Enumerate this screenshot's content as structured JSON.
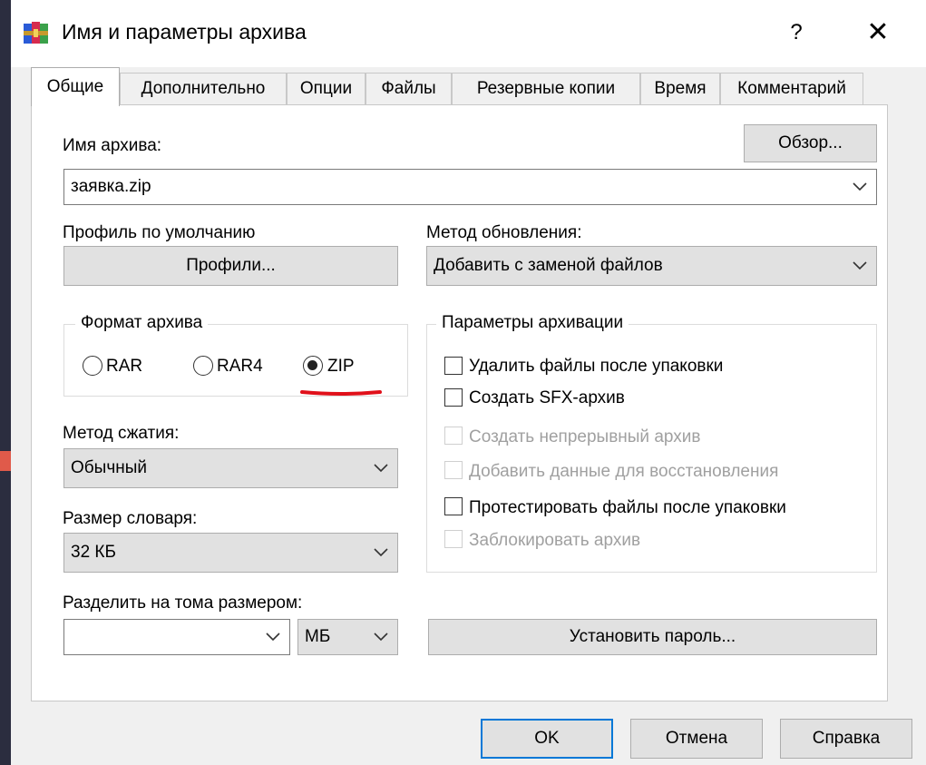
{
  "window": {
    "title": "Имя и параметры архива",
    "help": "?",
    "close": "✕"
  },
  "tabs": [
    {
      "label": "Общие",
      "active": true
    },
    {
      "label": "Дополнительно"
    },
    {
      "label": "Опции"
    },
    {
      "label": "Файлы"
    },
    {
      "label": "Резервные копии"
    },
    {
      "label": "Время"
    },
    {
      "label": "Комментарий"
    }
  ],
  "general": {
    "archive_name_label": "Имя архива:",
    "browse_button": "Обзор...",
    "archive_name_value": "заявка.zip",
    "profile_label": "Профиль по умолчанию",
    "profiles_button": "Профили...",
    "update_method_label": "Метод обновления:",
    "update_method_value": "Добавить с заменой файлов",
    "format_group_label": "Формат архива",
    "formats": [
      {
        "label": "RAR",
        "selected": false
      },
      {
        "label": "RAR4",
        "selected": false
      },
      {
        "label": "ZIP",
        "selected": true
      }
    ],
    "compression_method_label": "Метод сжатия:",
    "compression_method_value": "Обычный",
    "dictionary_size_label": "Размер словаря:",
    "dictionary_size_value": "32 КБ",
    "split_label": "Разделить на тома размером:",
    "split_value": "",
    "split_unit": "МБ",
    "set_password_button": "Установить пароль...",
    "options_group_label": "Параметры архивации",
    "options": [
      {
        "label": "Удалить файлы после упаковки",
        "checked": false,
        "enabled": true
      },
      {
        "label": "Создать SFX-архив",
        "checked": false,
        "enabled": true
      },
      {
        "label": "Создать непрерывный архив",
        "checked": false,
        "enabled": false
      },
      {
        "label": "Добавить данные для восстановления",
        "checked": false,
        "enabled": false
      },
      {
        "label": "Протестировать файлы после упаковки",
        "checked": false,
        "enabled": true
      },
      {
        "label": "Заблокировать архив",
        "checked": false,
        "enabled": false
      }
    ]
  },
  "footer": {
    "ok": "OK",
    "cancel": "Отмена",
    "help": "Справка"
  },
  "colors": {
    "annotation": "#e0101a",
    "focus_border": "#0078d7",
    "backdrop": "#2b2d3f"
  }
}
